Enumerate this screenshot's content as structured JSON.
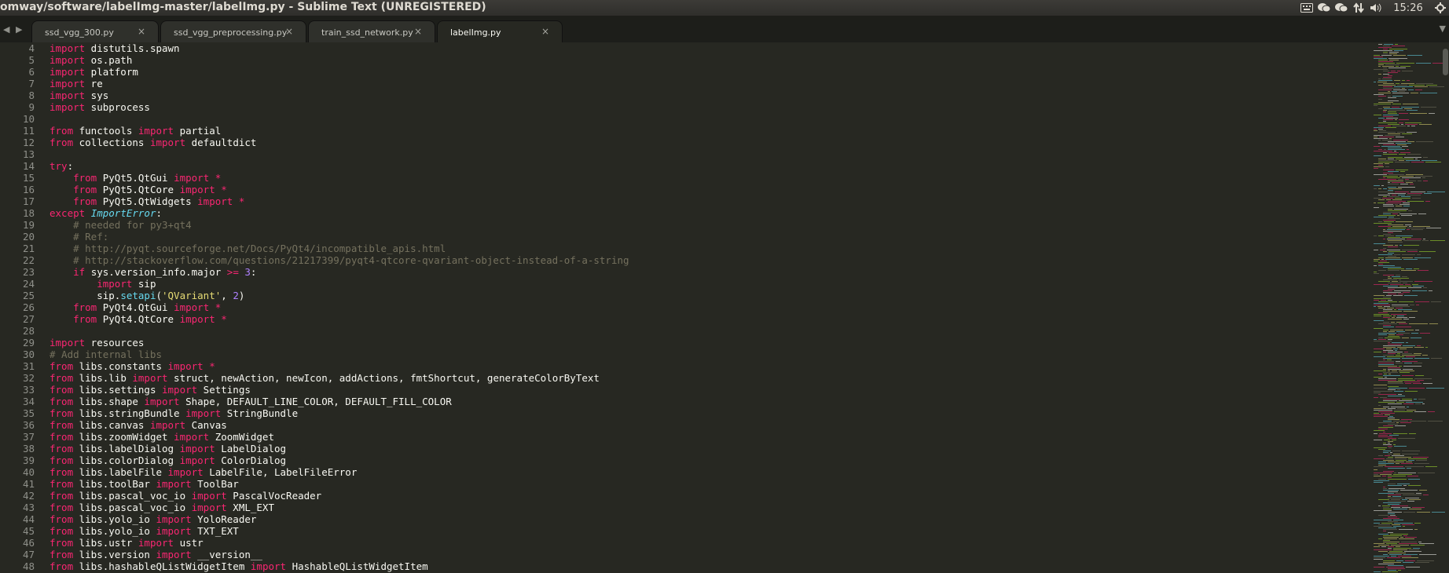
{
  "window": {
    "title": "omway/software/labelImg-master/labelImg.py - Sublime Text (UNREGISTERED)"
  },
  "tray": {
    "clock": "15:26",
    "icons": [
      "keyboard-icon",
      "wechat-icon",
      "wechat-icon",
      "network-icon",
      "volume-icon"
    ]
  },
  "colors": {
    "keyword": "#f92672",
    "class": "#66d9ef",
    "string": "#e6db74",
    "number": "#ae81ff",
    "comment": "#75715e",
    "text": "#f8f8f2",
    "background": "#272822"
  },
  "tabs": [
    {
      "label": "ssd_vgg_300.py",
      "active": false
    },
    {
      "label": "ssd_vgg_preprocessing.py",
      "active": false
    },
    {
      "label": "train_ssd_network.py",
      "active": false
    },
    {
      "label": "labelImg.py",
      "active": true
    }
  ],
  "lines": [
    {
      "n": "4",
      "tokens": [
        [
          "kw",
          "import"
        ],
        [
          "t",
          " distutils.spawn"
        ]
      ]
    },
    {
      "n": "5",
      "tokens": [
        [
          "kw",
          "import"
        ],
        [
          "t",
          " os.path"
        ]
      ]
    },
    {
      "n": "6",
      "tokens": [
        [
          "kw",
          "import"
        ],
        [
          "t",
          " platform"
        ]
      ]
    },
    {
      "n": "7",
      "tokens": [
        [
          "kw",
          "import"
        ],
        [
          "t",
          " re"
        ]
      ]
    },
    {
      "n": "8",
      "tokens": [
        [
          "kw",
          "import"
        ],
        [
          "t",
          " sys"
        ]
      ]
    },
    {
      "n": "9",
      "tokens": [
        [
          "kw",
          "import"
        ],
        [
          "t",
          " subprocess"
        ]
      ]
    },
    {
      "n": "10",
      "tokens": []
    },
    {
      "n": "11",
      "tokens": [
        [
          "kw",
          "from"
        ],
        [
          "t",
          " functools "
        ],
        [
          "kw",
          "import"
        ],
        [
          "t",
          " partial"
        ]
      ]
    },
    {
      "n": "12",
      "tokens": [
        [
          "kw",
          "from"
        ],
        [
          "t",
          " collections "
        ],
        [
          "kw",
          "import"
        ],
        [
          "t",
          " defaultdict"
        ]
      ]
    },
    {
      "n": "13",
      "tokens": []
    },
    {
      "n": "14",
      "tokens": [
        [
          "kw",
          "try"
        ],
        [
          "t",
          ":"
        ]
      ]
    },
    {
      "n": "15",
      "tokens": [
        [
          "t",
          "    "
        ],
        [
          "kw",
          "from"
        ],
        [
          "t",
          " PyQt5.QtGui "
        ],
        [
          "kw",
          "import"
        ],
        [
          "t",
          " "
        ],
        [
          "kw",
          "*"
        ]
      ]
    },
    {
      "n": "16",
      "tokens": [
        [
          "t",
          "    "
        ],
        [
          "kw",
          "from"
        ],
        [
          "t",
          " PyQt5.QtCore "
        ],
        [
          "kw",
          "import"
        ],
        [
          "t",
          " "
        ],
        [
          "kw",
          "*"
        ]
      ]
    },
    {
      "n": "17",
      "tokens": [
        [
          "t",
          "    "
        ],
        [
          "kw",
          "from"
        ],
        [
          "t",
          " PyQt5.QtWidgets "
        ],
        [
          "kw",
          "import"
        ],
        [
          "t",
          " "
        ],
        [
          "kw",
          "*"
        ]
      ]
    },
    {
      "n": "18",
      "tokens": [
        [
          "kw",
          "except"
        ],
        [
          "t",
          " "
        ],
        [
          "cls",
          "ImportError"
        ],
        [
          "t",
          ":"
        ]
      ]
    },
    {
      "n": "19",
      "tokens": [
        [
          "t",
          "    "
        ],
        [
          "cm",
          "# needed for py3+qt4"
        ]
      ]
    },
    {
      "n": "20",
      "tokens": [
        [
          "t",
          "    "
        ],
        [
          "cm",
          "# Ref:"
        ]
      ]
    },
    {
      "n": "21",
      "tokens": [
        [
          "t",
          "    "
        ],
        [
          "cm",
          "# http://pyqt.sourceforge.net/Docs/PyQt4/incompatible_apis.html"
        ]
      ]
    },
    {
      "n": "22",
      "tokens": [
        [
          "t",
          "    "
        ],
        [
          "cm",
          "# http://stackoverflow.com/questions/21217399/pyqt4-qtcore-qvariant-object-instead-of-a-string"
        ]
      ]
    },
    {
      "n": "23",
      "tokens": [
        [
          "t",
          "    "
        ],
        [
          "kw",
          "if"
        ],
        [
          "t",
          " sys.version_info.major "
        ],
        [
          "kw",
          ">="
        ],
        [
          "t",
          " "
        ],
        [
          "num",
          "3"
        ],
        [
          "t",
          ":"
        ]
      ]
    },
    {
      "n": "24",
      "tokens": [
        [
          "t",
          "        "
        ],
        [
          "kw",
          "import"
        ],
        [
          "t",
          " sip"
        ]
      ]
    },
    {
      "n": "25",
      "tokens": [
        [
          "t",
          "        sip."
        ],
        [
          "fn",
          "setapi"
        ],
        [
          "t",
          "("
        ],
        [
          "str",
          "'QVariant'"
        ],
        [
          "t",
          ", "
        ],
        [
          "num",
          "2"
        ],
        [
          "t",
          ")"
        ]
      ]
    },
    {
      "n": "26",
      "tokens": [
        [
          "t",
          "    "
        ],
        [
          "kw",
          "from"
        ],
        [
          "t",
          " PyQt4.QtGui "
        ],
        [
          "kw",
          "import"
        ],
        [
          "t",
          " "
        ],
        [
          "kw",
          "*"
        ]
      ]
    },
    {
      "n": "27",
      "tokens": [
        [
          "t",
          "    "
        ],
        [
          "kw",
          "from"
        ],
        [
          "t",
          " PyQt4.QtCore "
        ],
        [
          "kw",
          "import"
        ],
        [
          "t",
          " "
        ],
        [
          "kw",
          "*"
        ]
      ]
    },
    {
      "n": "28",
      "tokens": []
    },
    {
      "n": "29",
      "tokens": [
        [
          "kw",
          "import"
        ],
        [
          "t",
          " resources"
        ]
      ]
    },
    {
      "n": "30",
      "tokens": [
        [
          "cm",
          "# Add internal libs"
        ]
      ]
    },
    {
      "n": "31",
      "tokens": [
        [
          "kw",
          "from"
        ],
        [
          "t",
          " libs.constants "
        ],
        [
          "kw",
          "import"
        ],
        [
          "t",
          " "
        ],
        [
          "kw",
          "*"
        ]
      ]
    },
    {
      "n": "32",
      "tokens": [
        [
          "kw",
          "from"
        ],
        [
          "t",
          " libs.lib "
        ],
        [
          "kw",
          "import"
        ],
        [
          "t",
          " struct, newAction, newIcon, addActions, fmtShortcut, generateColorByText"
        ]
      ]
    },
    {
      "n": "33",
      "tokens": [
        [
          "kw",
          "from"
        ],
        [
          "t",
          " libs.settings "
        ],
        [
          "kw",
          "import"
        ],
        [
          "t",
          " Settings"
        ]
      ]
    },
    {
      "n": "34",
      "tokens": [
        [
          "kw",
          "from"
        ],
        [
          "t",
          " libs.shape "
        ],
        [
          "kw",
          "import"
        ],
        [
          "t",
          " Shape, DEFAULT_LINE_COLOR, DEFAULT_FILL_COLOR"
        ]
      ]
    },
    {
      "n": "35",
      "tokens": [
        [
          "kw",
          "from"
        ],
        [
          "t",
          " libs.stringBundle "
        ],
        [
          "kw",
          "import"
        ],
        [
          "t",
          " StringBundle"
        ]
      ]
    },
    {
      "n": "36",
      "tokens": [
        [
          "kw",
          "from"
        ],
        [
          "t",
          " libs.canvas "
        ],
        [
          "kw",
          "import"
        ],
        [
          "t",
          " Canvas"
        ]
      ]
    },
    {
      "n": "37",
      "tokens": [
        [
          "kw",
          "from"
        ],
        [
          "t",
          " libs.zoomWidget "
        ],
        [
          "kw",
          "import"
        ],
        [
          "t",
          " ZoomWidget"
        ]
      ]
    },
    {
      "n": "38",
      "tokens": [
        [
          "kw",
          "from"
        ],
        [
          "t",
          " libs.labelDialog "
        ],
        [
          "kw",
          "import"
        ],
        [
          "t",
          " LabelDialog"
        ]
      ]
    },
    {
      "n": "39",
      "tokens": [
        [
          "kw",
          "from"
        ],
        [
          "t",
          " libs.colorDialog "
        ],
        [
          "kw",
          "import"
        ],
        [
          "t",
          " ColorDialog"
        ]
      ]
    },
    {
      "n": "40",
      "tokens": [
        [
          "kw",
          "from"
        ],
        [
          "t",
          " libs.labelFile "
        ],
        [
          "kw",
          "import"
        ],
        [
          "t",
          " LabelFile, LabelFileError"
        ]
      ]
    },
    {
      "n": "41",
      "tokens": [
        [
          "kw",
          "from"
        ],
        [
          "t",
          " libs.toolBar "
        ],
        [
          "kw",
          "import"
        ],
        [
          "t",
          " ToolBar"
        ]
      ]
    },
    {
      "n": "42",
      "tokens": [
        [
          "kw",
          "from"
        ],
        [
          "t",
          " libs.pascal_voc_io "
        ],
        [
          "kw",
          "import"
        ],
        [
          "t",
          " PascalVocReader"
        ]
      ]
    },
    {
      "n": "43",
      "tokens": [
        [
          "kw",
          "from"
        ],
        [
          "t",
          " libs.pascal_voc_io "
        ],
        [
          "kw",
          "import"
        ],
        [
          "t",
          " XML_EXT"
        ]
      ]
    },
    {
      "n": "44",
      "tokens": [
        [
          "kw",
          "from"
        ],
        [
          "t",
          " libs.yolo_io "
        ],
        [
          "kw",
          "import"
        ],
        [
          "t",
          " YoloReader"
        ]
      ]
    },
    {
      "n": "45",
      "tokens": [
        [
          "kw",
          "from"
        ],
        [
          "t",
          " libs.yolo_io "
        ],
        [
          "kw",
          "import"
        ],
        [
          "t",
          " TXT_EXT"
        ]
      ]
    },
    {
      "n": "46",
      "tokens": [
        [
          "kw",
          "from"
        ],
        [
          "t",
          " libs.ustr "
        ],
        [
          "kw",
          "import"
        ],
        [
          "t",
          " ustr"
        ]
      ]
    },
    {
      "n": "47",
      "tokens": [
        [
          "kw",
          "from"
        ],
        [
          "t",
          " libs.version "
        ],
        [
          "kw",
          "import"
        ],
        [
          "t",
          " __version__"
        ]
      ]
    },
    {
      "n": "48",
      "tokens": [
        [
          "kw",
          "from"
        ],
        [
          "t",
          " libs.hashableQListWidgetItem "
        ],
        [
          "kw",
          "import"
        ],
        [
          "t",
          " HashableQListWidgetItem"
        ]
      ]
    }
  ]
}
